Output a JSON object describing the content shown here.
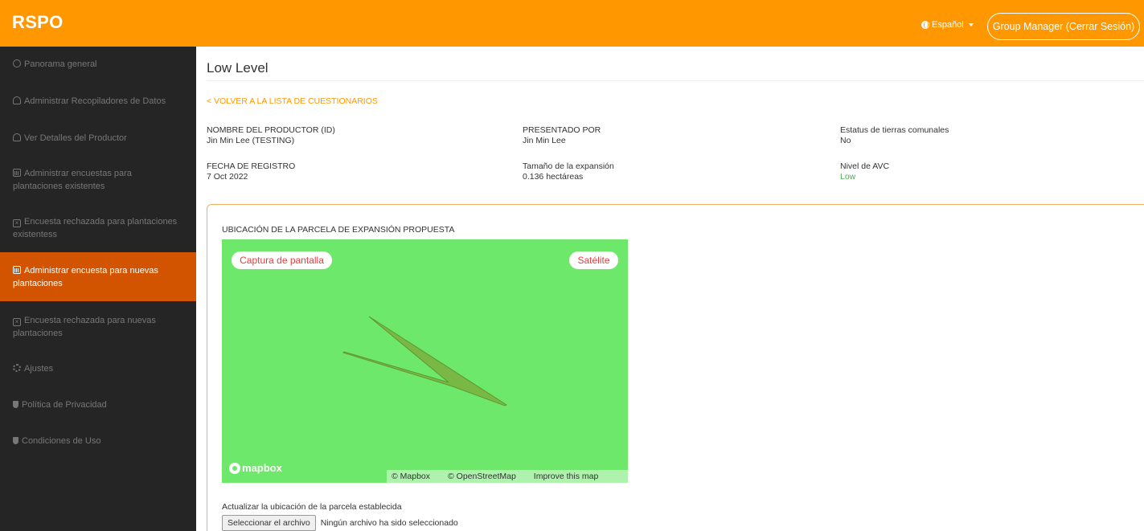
{
  "header": {
    "brand": "RSPO",
    "language": "Español",
    "logout_label": "Group Manager (Cerrar Sesión)"
  },
  "sidebar": {
    "items": [
      {
        "label": "Panorama general",
        "icon": "dashboard-icon"
      },
      {
        "label": "Administrar Recopiladores de Datos",
        "icon": "users-icon"
      },
      {
        "label": "Ver Detalles del Productor",
        "icon": "users-icon"
      },
      {
        "label": "Administrar encuestas para plantaciones existentes",
        "icon": "bar-chart-icon"
      },
      {
        "label": "Encuesta rechazada para plantaciones existentess",
        "icon": "close-box-icon"
      },
      {
        "label": "Administrar encuesta para nuevas plantaciones",
        "icon": "bar-chart-icon",
        "active": true
      },
      {
        "label": "Encuesta rechazada para nuevas plantaciones",
        "icon": "close-box-icon"
      },
      {
        "label": "Ajustes",
        "icon": "gear-icon"
      },
      {
        "label": "Política de Privacidad",
        "icon": "shield-icon"
      },
      {
        "label": "Condiciones de Uso",
        "icon": "shield-icon"
      }
    ]
  },
  "main": {
    "title": "Low Level",
    "back_link": "< VOLVER A LA LISTA DE CUESTIONARIOS",
    "fields": {
      "producer": {
        "label": "NOMBRE DEL PRODUCTOR (ID)",
        "value": "Jin Min Lee (TESTING)"
      },
      "submitted_by": {
        "label": "PRESENTADO POR",
        "value": "Jin Min Lee"
      },
      "land_status": {
        "label": "Estatus de tierras comunales",
        "value": "No"
      },
      "reg_date": {
        "label": "FECHA DE REGISTRO",
        "value": "7 Oct 2022"
      },
      "expansion_size": {
        "label": "Tamaño de la expansión",
        "value": "0.136 hectáreas"
      },
      "avc_level": {
        "label": "Nivel de AVC",
        "value": "Low"
      }
    },
    "panel": {
      "title": "UBICACIÓN DE LA PARCELA DE EXPANSIÓN PROPUESTA",
      "map": {
        "screenshot_label": "Captura de pantalla",
        "satellite_label": "Satélite",
        "logo_text": "mapbox",
        "attrib_mapbox": "© Mapbox",
        "attrib_osm": "© OpenStreetMap",
        "attrib_improve": "Improve this map"
      },
      "update_label": "Actualizar la ubicación de la parcela establecida",
      "file_button": "Seleccionar el archivo",
      "file_status": "Ningún archivo ha sido seleccionado"
    }
  },
  "colors": {
    "brand": "#ff9800",
    "sidebar_bg": "#252525",
    "active_bg": "#d35400",
    "map_green": "#6ee86a",
    "polygon": "#7cb342",
    "low_green": "#4caf50"
  }
}
